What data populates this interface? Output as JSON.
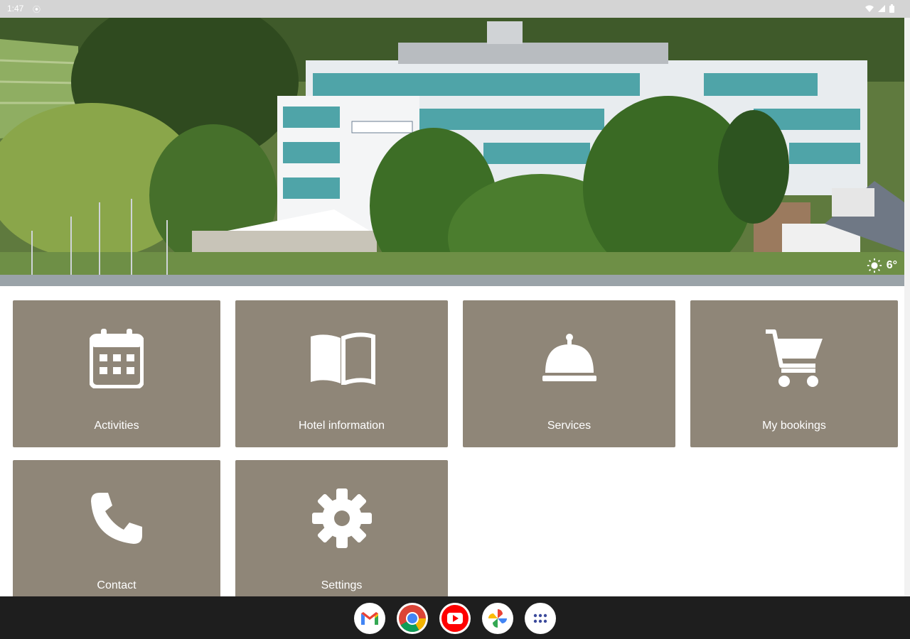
{
  "status_bar": {
    "time": "1:47",
    "icons": [
      "location-icon",
      "wifi-icon",
      "signal-icon",
      "battery-icon"
    ]
  },
  "hero": {
    "image": "hotel-building-photo",
    "weather": {
      "icon": "partly-sunny-icon",
      "temperature": "6°"
    }
  },
  "tiles": [
    {
      "label": "Activities",
      "icon": "calendar-icon"
    },
    {
      "label": "Hotel information",
      "icon": "book-icon"
    },
    {
      "label": "Services",
      "icon": "service-bell-icon"
    },
    {
      "label": "My bookings",
      "icon": "cart-icon"
    },
    {
      "label": "Contact",
      "icon": "phone-icon"
    },
    {
      "label": "Settings",
      "icon": "gear-icon"
    }
  ],
  "dock": {
    "apps": [
      "gmail-icon",
      "chrome-icon",
      "youtube-icon",
      "photos-icon",
      "app-drawer-icon"
    ]
  },
  "colors": {
    "tile": "#8f8678",
    "status_bar": "#d4d4d4",
    "dock": "#1e1e1e"
  }
}
